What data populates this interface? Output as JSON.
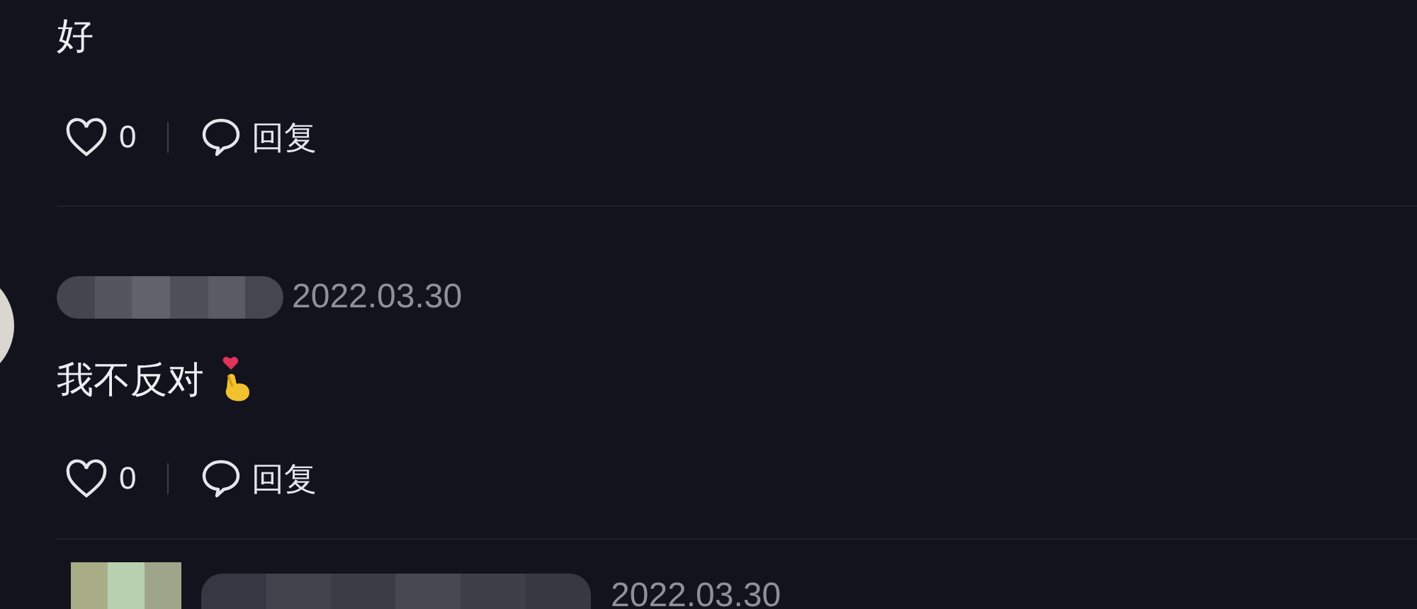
{
  "comments": [
    {
      "text": "好",
      "likes": "0",
      "liked": false,
      "reply": "回复"
    },
    {
      "date": "2022.03.30",
      "text": "我不反对",
      "emoji": true,
      "likes": "0",
      "liked": false,
      "reply": "回复"
    },
    {
      "date": "2022.03.30"
    }
  ]
}
